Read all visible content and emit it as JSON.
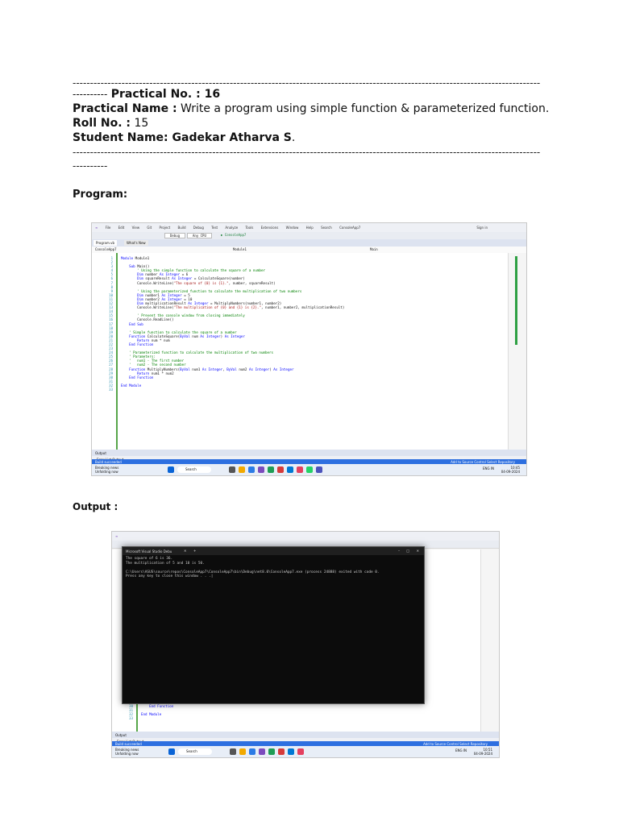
{
  "doc": {
    "dash_line_1": "-----------------------------------------------------------------------------------------------------------------------------------------------------------------",
    "dash_prefix": "----------",
    "practical_no_label": "Practical No. : 16",
    "practical_name_label": "Practical Name :",
    "practical_name_value": "Write a program using simple function & parameterized function.",
    "roll_no_label": "Roll No. :",
    "roll_no_value": "15",
    "student_name_label": "Student Name: Gadekar Atharva S",
    "student_name_suffix": ".",
    "dash_line_2": "-----------------------------------------------------------------------------------------------------------------------------------------------------------------",
    "dash_line_3": "----------",
    "program_heading": "Program:",
    "output_heading": "Output :"
  },
  "program_shot": {
    "menu": [
      "File",
      "Edit",
      "View",
      "Git",
      "Project",
      "Build",
      "Debug",
      "Test",
      "Analyze",
      "Tools",
      "Extensions",
      "Window",
      "Help",
      "Search",
      "ConsoleApp7"
    ],
    "sign_in": "Sign in",
    "config": "Debug",
    "platform": "Any CPU",
    "run_target": "ConsoleApp7",
    "tab_file": "Program.vb",
    "tab_whats_new": "What's New",
    "nav_project": "ConsoleApp7",
    "nav_module": "Module1",
    "nav_member": "Main",
    "line_numbers": "1\n2\n3\n4\n5\n6\n7\n8\n9\n10\n11\n12\n13\n14\n15\n16\n17\n18\n19\n20\n21\n22\n23\n24\n25\n26\n27\n28\n29\n30\n31\n32\n33",
    "code": [
      "Module Module1",
      "",
      "    Sub Main()",
      "        ' Using the simple function to calculate the square of a number",
      "        Dim number As Integer = 6",
      "        Dim squareResult As Integer = CalculateSquare(number)",
      "        Console.WriteLine(\"The square of {0} is {1}.\", number, squareResult)",
      "",
      "        ' Using the parameterized function to calculate the multiplication of two numbers",
      "        Dim number1 As Integer = 5",
      "        Dim number2 As Integer = 10",
      "        Dim multiplicationResult As Integer = MultiplyNumbers(number1, number2)",
      "        Console.WriteLine(\"The multiplication of {0} and {1} is {2}.\", number1, number2, multiplicationResult)",
      "",
      "        ' Prevent the console window from closing immediately",
      "        Console.ReadLine()",
      "    End Sub",
      "",
      "    ' Simple function to calculate the square of a number",
      "    Function CalculateSquare(ByVal num As Integer) As Integer",
      "        Return num * num",
      "    End Function",
      "",
      "    ' Parameterized function to calculate the multiplication of two numbers",
      "    ' Parameters:",
      "    '   num1 - The first number",
      "    '   num2 - The second number",
      "    Function MultiplyNumbers(ByVal num1 As Integer, ByVal num2 As Integer) As Integer",
      "        Return num1 * num2",
      "    End Function",
      "",
      "End Module",
      ""
    ],
    "output_panel": "Output",
    "output_tabs": "Error List   Output",
    "status_left": "Build succeeded",
    "status_right": "Add to Source Control   Select Repository",
    "weather": "Breaking news",
    "weather_sub": "Unfolding now",
    "search_label": "Search",
    "clock_time": "10:45",
    "clock_date": "04-09-2024",
    "lang": "ENG IN"
  },
  "output_shot": {
    "console_title": "Microsoft Visual Studio Debu",
    "console_lines": "The square of 6 is 36.\nThe multiplication of 5 and 10 is 50.\n\nC:\\Users\\ASUS\\source\\repos\\ConsoleApp7\\ConsoleApp7\\bin\\Debug\\net8.0\\ConsoleApp7.exe (process 24888) exited with code 0.\nPress any key to close this window . . .|",
    "behind_line_numbers": "30\n31\n32\n33",
    "behind_code_1": "    End Function",
    "behind_code_2": "End Module",
    "output_panel": "Output",
    "output_tabs": "Error List   Output",
    "status_left": "Build succeeded",
    "status_right": "Add to Source Control   Select Repository",
    "weather": "Breaking news",
    "weather_sub": "Unfolding now",
    "search_label": "Search",
    "clock_time": "10:51",
    "clock_date": "04-09-2024",
    "lang": "ENG IN"
  },
  "colors": {
    "vs_accent": "#2d6fe0",
    "code_keyword": "#0000ff",
    "code_comment": "#008000",
    "code_string": "#a31515",
    "console_bg": "#0c0c0c"
  }
}
